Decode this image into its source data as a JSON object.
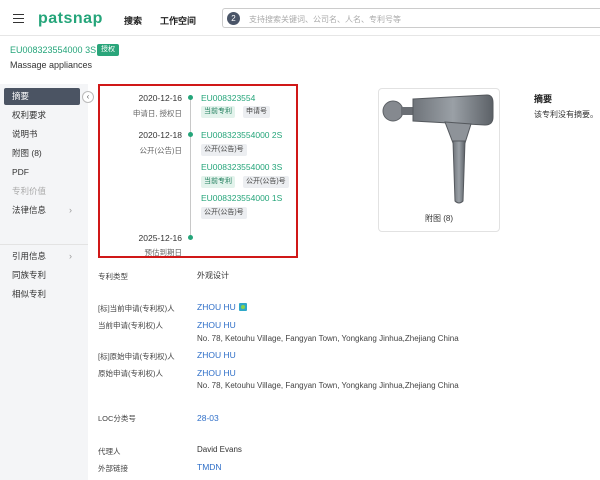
{
  "topbar": {
    "logo": "patsnap",
    "nav": [
      "搜索",
      "工作空间"
    ],
    "search_count": "2",
    "search_placeholder": "支持搜索关键词、公司名、人名、专利号等"
  },
  "header": {
    "publication_number": "EU008323554000 3S",
    "status_badge": "授权",
    "title": "Massage appliances"
  },
  "sidebar": {
    "items": [
      {
        "label": "摘要",
        "state": "active"
      },
      {
        "label": "权利要求",
        "state": "normal"
      },
      {
        "label": "说明书",
        "state": "normal"
      },
      {
        "label": "附图 (8)",
        "state": "normal"
      },
      {
        "label": "PDF",
        "state": "normal"
      },
      {
        "label": "专利价值",
        "state": "disabled"
      },
      {
        "label": "法律信息",
        "state": "normal",
        "chevron": "›"
      },
      {
        "label": "引用信息",
        "state": "normal",
        "chevron": "›"
      },
      {
        "label": "同族专利",
        "state": "normal"
      },
      {
        "label": "相似专利",
        "state": "normal"
      }
    ],
    "collapse_icon": "‹"
  },
  "timeline": {
    "events": [
      {
        "date": "2020-12-16",
        "label": "申请日, 授权日",
        "entries": [
          {
            "number": "EU008323554",
            "tags": [
              {
                "text": "当前专利",
                "style": "green"
              },
              {
                "text": "申请号",
                "style": "gray"
              }
            ]
          }
        ]
      },
      {
        "date": "2020-12-18",
        "label": "公开(公告)日",
        "entries": [
          {
            "number": "EU008323554000 2S",
            "tags": [
              {
                "text": "公开(公告)号",
                "style": "gray"
              }
            ]
          },
          {
            "number": "EU008323554000 3S",
            "tags": [
              {
                "text": "当前专利",
                "style": "green"
              },
              {
                "text": "公开(公告)号",
                "style": "gray"
              }
            ]
          },
          {
            "number": "EU008323554000 1S",
            "tags": [
              {
                "text": "公开(公告)号",
                "style": "gray"
              }
            ]
          }
        ]
      },
      {
        "date": "2025-12-16",
        "label": "预估到期日",
        "entries": []
      }
    ]
  },
  "figure": {
    "caption": "附图 (8)"
  },
  "abstract": {
    "title": "摘要",
    "text": "该专利没有摘要。"
  },
  "fields": [
    {
      "label": "专利类型",
      "value": "外观设计"
    },
    {
      "label": "[标]当前申请(专利权)人",
      "value": "ZHOU HU",
      "link": true,
      "icon": "party-icon"
    },
    {
      "label": "当前申请(专利权)人",
      "value": "ZHOU HU",
      "link": true,
      "sub": "No. 78, Ketouhu Village, Fangyan Town, Yongkang Jinhua,Zhejiang China"
    },
    {
      "label": "[标]原始申请(专利权)人",
      "value": "ZHOU HU",
      "link": true
    },
    {
      "label": "原始申请(专利权)人",
      "value": "ZHOU HU",
      "link": true,
      "sub": "No. 78, Ketouhu Village, Fangyan Town, Yongkang Jinhua,Zhejiang China"
    },
    {
      "label": "LOC分类号",
      "value": "28-03",
      "link": true
    },
    {
      "label": "代理人",
      "value": "David Evans"
    },
    {
      "label": "外部链接",
      "value": "TMDN",
      "link": true
    }
  ]
}
